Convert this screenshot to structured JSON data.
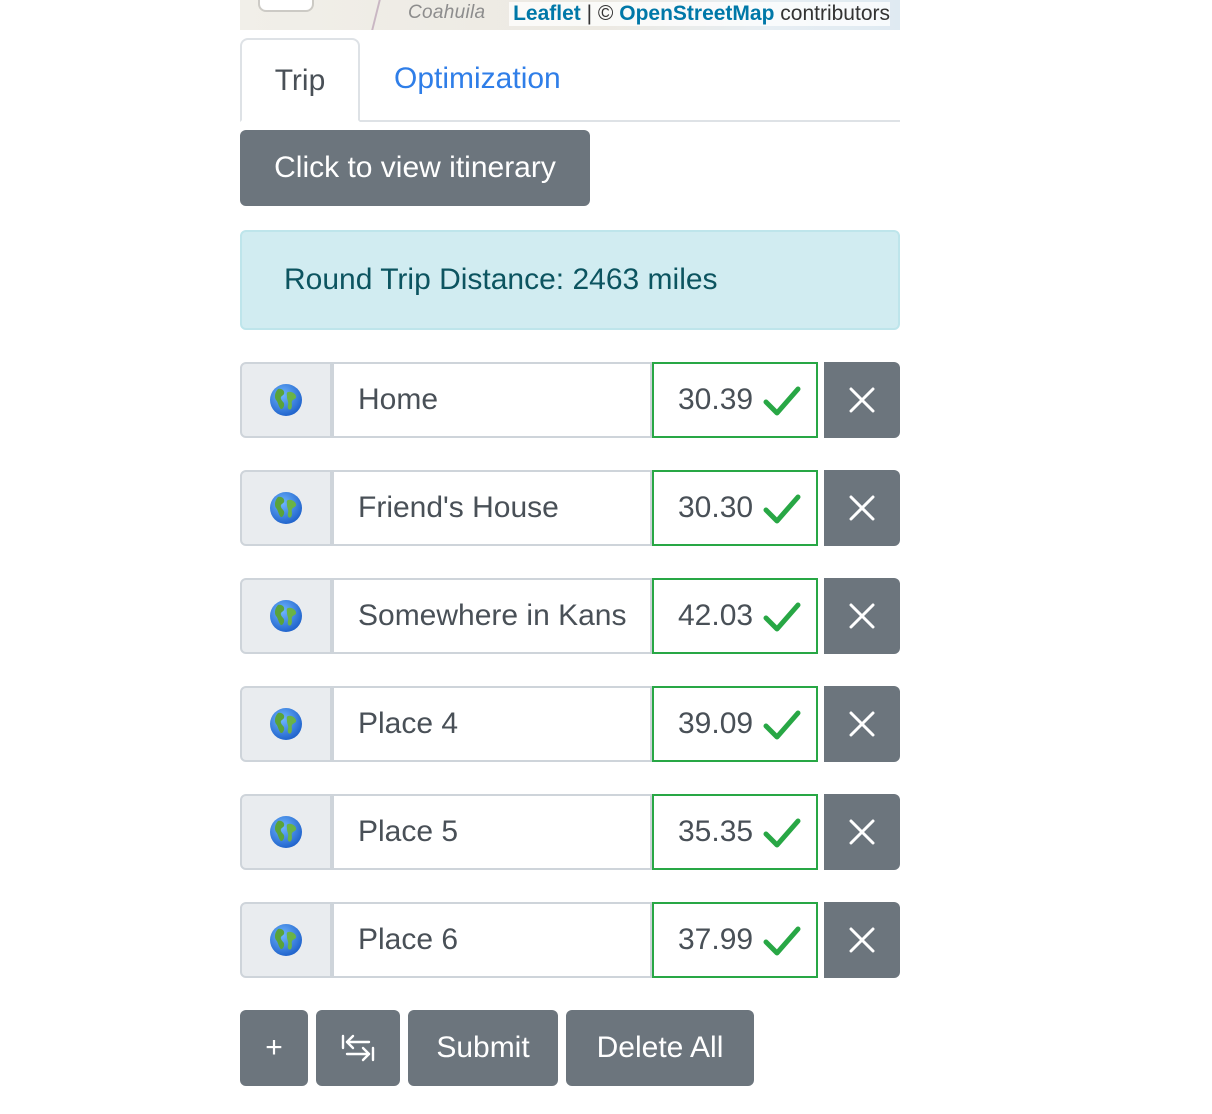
{
  "map": {
    "place_label": "Coahuila",
    "attribution": {
      "leaflet": "Leaflet",
      "separator": " | © ",
      "osm": "OpenStreetMap",
      "suffix": " contributors"
    }
  },
  "tabs": [
    {
      "label": "Trip",
      "active": true
    },
    {
      "label": "Optimization",
      "active": false
    }
  ],
  "itinerary_button": "Click to view itinerary",
  "distance_alert": "Round Trip Distance: 2463 miles",
  "places": [
    {
      "name": "Home",
      "coords": "30.39",
      "valid": true
    },
    {
      "name": "Friend's House",
      "coords": "30.30",
      "valid": true
    },
    {
      "name": "Somewhere in Kansas",
      "coords": "42.03",
      "valid": true
    },
    {
      "name": "Place 4",
      "coords": "39.09",
      "valid": true
    },
    {
      "name": "Place 5",
      "coords": "35.35",
      "valid": true
    },
    {
      "name": "Place 6",
      "coords": "37.99",
      "valid": true
    }
  ],
  "icons": {
    "globe": "globe-americas-icon",
    "check": "check-icon",
    "remove": "close-icon",
    "reverse": "reverse-arrows-icon"
  },
  "bottom_buttons": {
    "add": "+",
    "submit": "Submit",
    "delete_all": "Delete All"
  },
  "colors": {
    "secondary": "#6c757d",
    "success": "#28a745",
    "info_bg": "#d1ecf1",
    "info_text": "#0c5460",
    "link": "#2f7ee8"
  }
}
